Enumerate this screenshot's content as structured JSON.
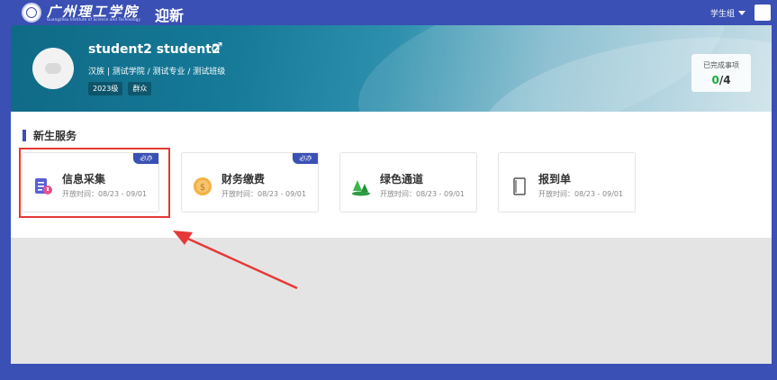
{
  "header": {
    "school_name": "广州理工学院",
    "school_name_en": "Guangzhou Institute of Science and Technology",
    "app_title": "迎新",
    "role_select": "学生组"
  },
  "profile": {
    "name": "student2  student2",
    "gender_symbol": "♂",
    "info": "汉族 | 测试学院 / 测试专业 / 测试班级",
    "badges": [
      "2023级",
      "群众"
    ],
    "completed_label": "已完成事项",
    "completed_done": "0",
    "completed_total": "/4"
  },
  "services": {
    "section_title": "新生服务",
    "cards": [
      {
        "title": "信息采集",
        "period": "开放时间：08/23 - 09/01",
        "tag": "必办",
        "icon": "form-icon"
      },
      {
        "title": "财务缴费",
        "period": "开放时间：08/23 - 09/01",
        "tag": "必办",
        "icon": "coin-icon"
      },
      {
        "title": "绿色通道",
        "period": "开放时间：08/23 - 09/01",
        "tag": "",
        "icon": "trees-icon"
      },
      {
        "title": "报到单",
        "period": "开放时间：08/23 - 09/01",
        "tag": "",
        "icon": "document-icon"
      }
    ]
  },
  "colors": {
    "primary": "#3a50b4",
    "highlight": "#e53935",
    "success": "#1aad3a"
  }
}
